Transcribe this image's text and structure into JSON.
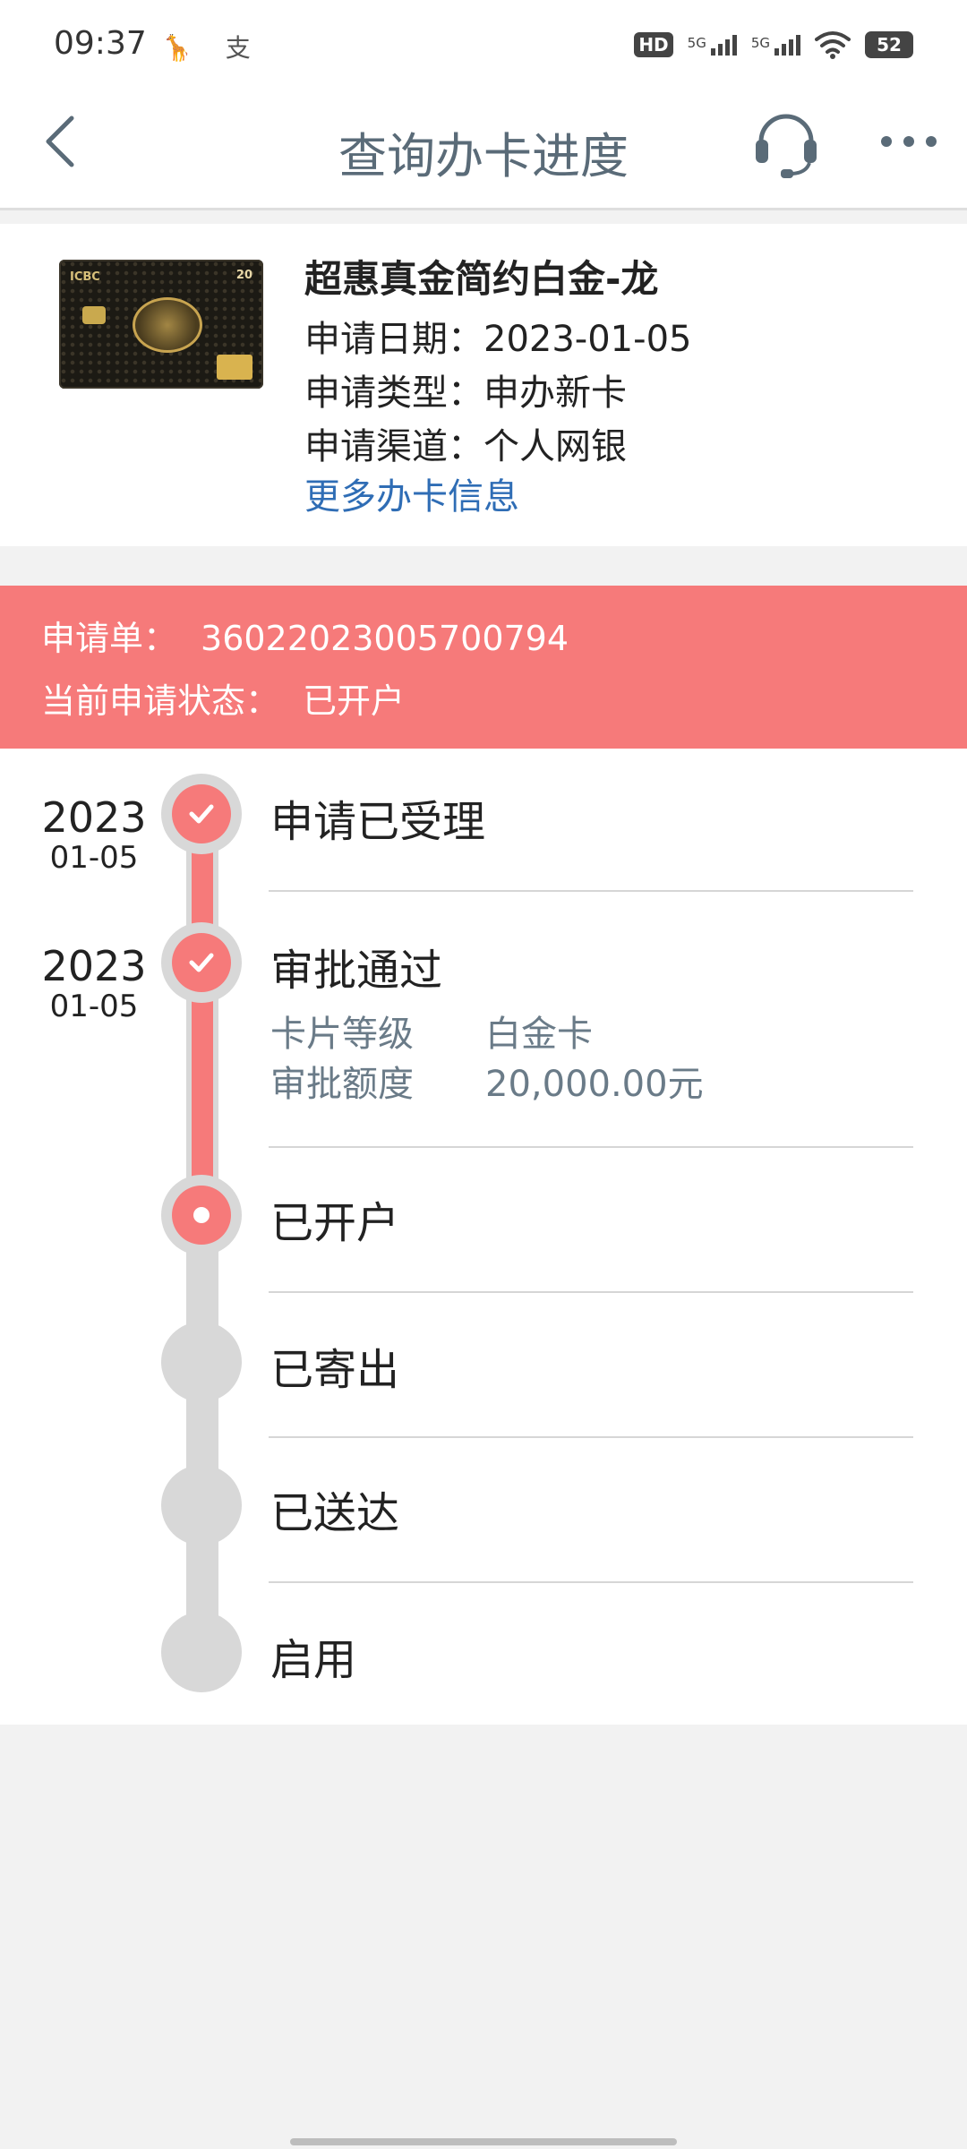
{
  "status_bar": {
    "time": "09:37",
    "app_icons": "🦒 支",
    "hd": "HD",
    "signal1_label": "5G",
    "signal2_label": "5G",
    "battery": "52"
  },
  "nav": {
    "title": "查询办卡进度"
  },
  "card": {
    "name": "超惠真金简约白金-龙",
    "brand_text": "ICBC",
    "badge_text": "20",
    "date_label": "申请日期：",
    "date_value": "2023-01-05",
    "type_label": "申请类型：",
    "type_value": "申办新卡",
    "channel_label": "申请渠道：",
    "channel_value": "个人网银",
    "more_link": "更多办卡信息"
  },
  "banner": {
    "order_label": "申请单：",
    "order_value": "36022023005700794",
    "status_label": "当前申请状态：",
    "status_value": "已开户"
  },
  "steps": [
    {
      "label": "申请已受理",
      "year": "2023",
      "md": "01-05",
      "state": "done"
    },
    {
      "label": "审批通过",
      "year": "2023",
      "md": "01-05",
      "state": "done",
      "details": [
        {
          "label": "卡片等级",
          "value": "白金卡"
        },
        {
          "label": "审批额度",
          "value": "20,000.00元"
        }
      ]
    },
    {
      "label": "已开户",
      "state": "current"
    },
    {
      "label": "已寄出",
      "state": "pending"
    },
    {
      "label": "已送达",
      "state": "pending"
    },
    {
      "label": "启用",
      "state": "pending"
    }
  ],
  "colors": {
    "accent": "#f67a7a",
    "link": "#2f6db5",
    "track_gray": "#d8d8d8",
    "title": "#5a6b78"
  },
  "icons": {
    "back": "chevron-left-icon",
    "support": "headset-icon",
    "more": "more-dots-icon",
    "check": "check-icon"
  }
}
